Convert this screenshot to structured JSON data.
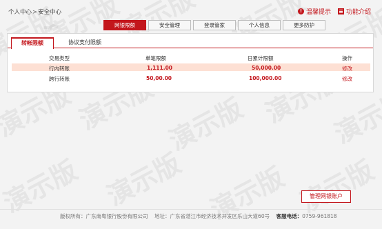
{
  "breadcrumb": {
    "home": "个人中心",
    "separator": ">",
    "current": "安全中心"
  },
  "top_links": {
    "tips": "温馨提示",
    "features": "功能介绍"
  },
  "main_tabs": [
    {
      "label": "网银限额",
      "active": true
    },
    {
      "label": "安全管理",
      "active": false
    },
    {
      "label": "登录管家",
      "active": false
    },
    {
      "label": "个人信息",
      "active": false
    },
    {
      "label": "更多防护",
      "active": false
    }
  ],
  "sub_tabs": {
    "active": "转帐限额",
    "other": "协议支付限额"
  },
  "table": {
    "headers": {
      "type": "交易类型",
      "single": "单笔限额",
      "daily": "日累计限额",
      "action": "操作"
    },
    "rows": [
      {
        "type": "行内转账",
        "single": "1,111.00",
        "daily": "50,000.00",
        "action": "修改"
      },
      {
        "type": "跨行转账",
        "single": "50,00.00",
        "daily": "100,000.00",
        "action": "修改"
      }
    ]
  },
  "manage_button": "管理网银账户",
  "footer": {
    "copyright": "版权所有：广东南粤银行股份有限公司",
    "address": "地址：广东省湛江市经济技术开发区乐山大道60号",
    "hotline_label": "客服电话：",
    "hotline": "0759-961818"
  },
  "watermark": "演示版",
  "colors": {
    "accent": "#c3161c",
    "row_highlight": "#fde0d4"
  }
}
